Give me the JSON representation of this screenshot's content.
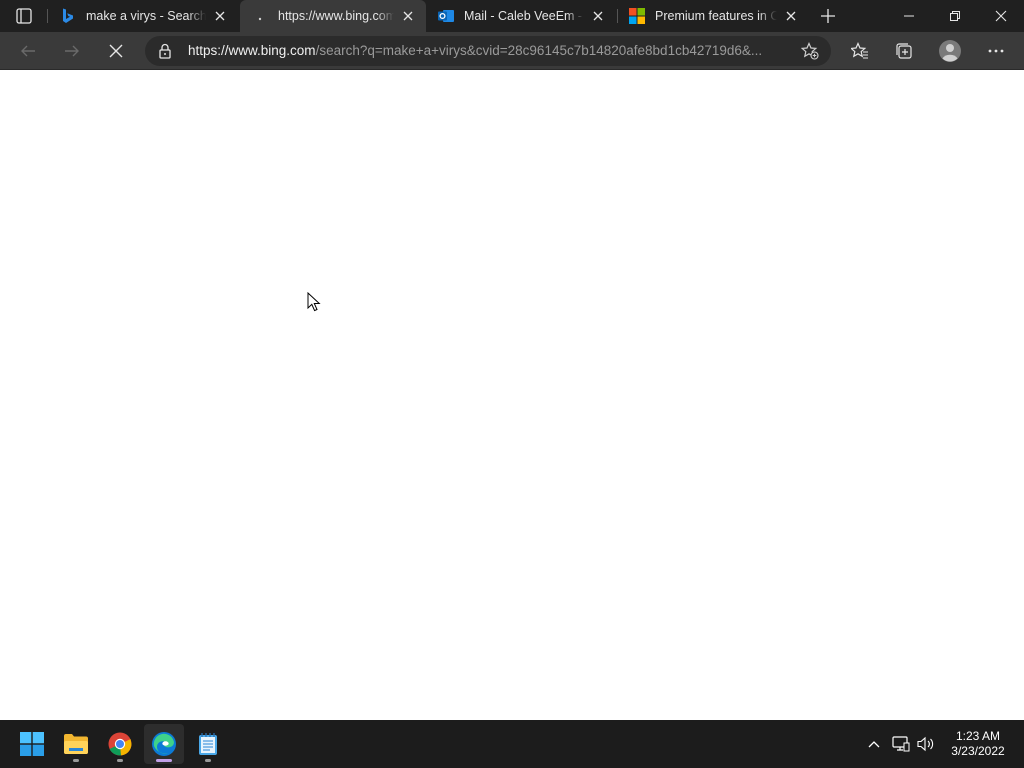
{
  "browser": {
    "tabs": [
      {
        "title": "make a virys - Search",
        "favicon": "bing-logo-icon",
        "active": false
      },
      {
        "title": "https://www.bing.com/",
        "favicon": "loading-icon",
        "active": true
      },
      {
        "title": "Mail - Caleb VeeEm - Ou",
        "favicon": "outlook-icon",
        "active": false
      },
      {
        "title": "Premium features in Ou",
        "favicon": "microsoft-logo-icon",
        "active": false
      }
    ],
    "address": {
      "host": "https://www.bing.com",
      "path": "/search?q=make+a+virys&cvid=28c96145c7b14820afe8bd1cb42719d6&..."
    },
    "colors": {
      "frame": "#202020",
      "toolbar": "#3a3a3a",
      "accent": "#c2a0e8"
    }
  },
  "taskbar": {
    "apps": [
      "start-icon",
      "file-explorer-icon",
      "chrome-icon",
      "edge-icon",
      "notepad-icon"
    ],
    "time": "1:23 AM",
    "date": "3/23/2022"
  }
}
